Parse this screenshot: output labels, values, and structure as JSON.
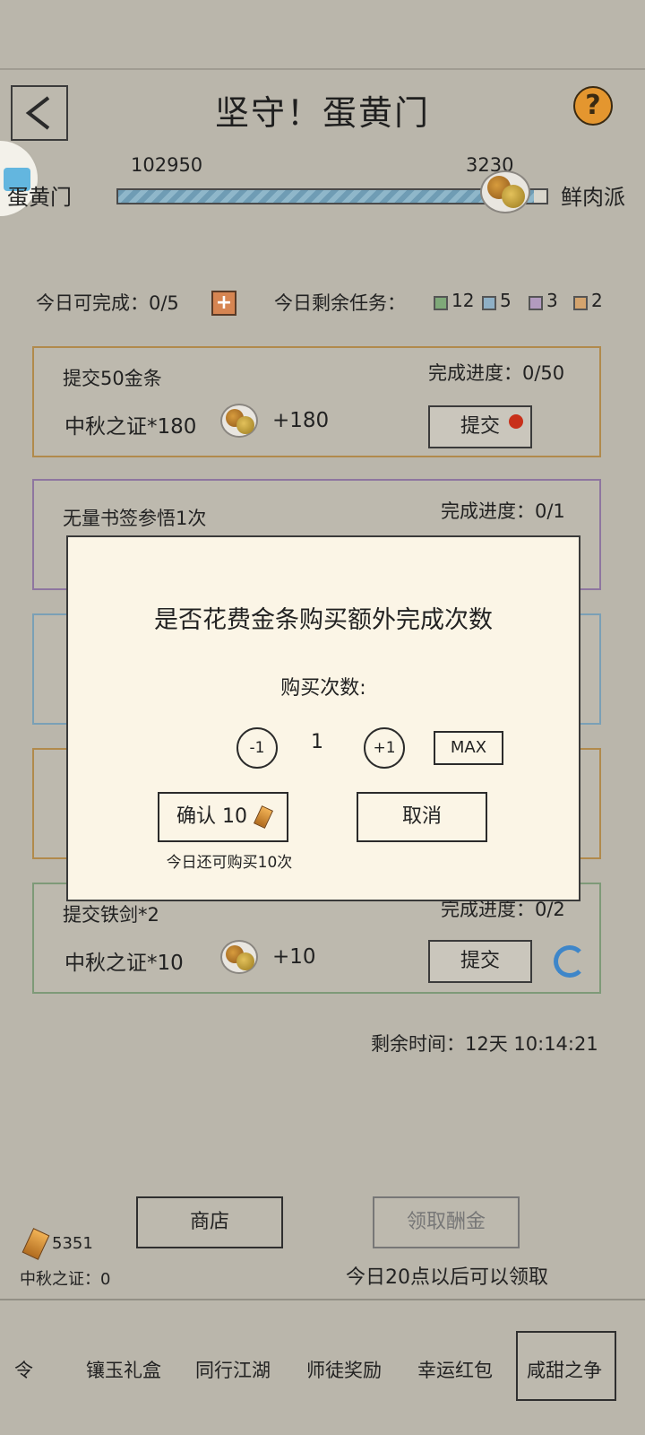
{
  "header": {
    "title": "坚守！蛋黄门",
    "back_icon": "back-arrow-icon",
    "help_label": "?"
  },
  "versus": {
    "left_team": "蛋黄门",
    "right_team": "鲜肉派",
    "left_score": "102950",
    "right_score": "3230",
    "progress_ratio": 0.97
  },
  "daily": {
    "can_complete_label": "今日可完成：",
    "can_complete_value": "0/5",
    "remaining_label": "今日剩余任务：",
    "chips": [
      {
        "count": "12",
        "color": "#7fa979"
      },
      {
        "count": "5",
        "color": "#8fb0c6"
      },
      {
        "count": "3",
        "color": "#b29bbf"
      },
      {
        "count": "2",
        "color": "#d4a46e"
      }
    ]
  },
  "tasks": [
    {
      "name": "提交50金条",
      "progress_label": "完成进度：",
      "progress": "0/50",
      "reward": "中秋之证*180",
      "reward_plus": "+180",
      "button": "提交",
      "border_color": "#b18a4c"
    },
    {
      "name": "无量书签参悟1次",
      "progress_label": "完成进度：",
      "progress": "0/1",
      "border_color": "#8e76a0"
    },
    {
      "name": "提交铁剑*2",
      "progress_label": "完成进度：",
      "progress": "0/2",
      "reward": "中秋之证*10",
      "reward_plus": "+10",
      "button": "提交",
      "border_color": "#7e9a78"
    }
  ],
  "remaining_time": "剩余时间：12天 10:14:21",
  "footer": {
    "gold_amount": "5351",
    "mid_autumn_cert": "中秋之证：0",
    "shop": "商店",
    "claim": "领取酬金",
    "claim_note": "今日20点以后可以领取"
  },
  "tabs": [
    "令",
    "镶玉礼盒",
    "同行江湖",
    "师徒奖励",
    "幸运红包",
    "咸甜之争"
  ],
  "modal": {
    "title": "是否花费金条购买额外完成次数",
    "buy_count_label": "购买次数:",
    "minus": "-1",
    "quantity": "1",
    "plus": "+1",
    "max": "MAX",
    "confirm": "确认 10",
    "cancel": "取消",
    "confirm_note": "今日还可购买10次"
  }
}
